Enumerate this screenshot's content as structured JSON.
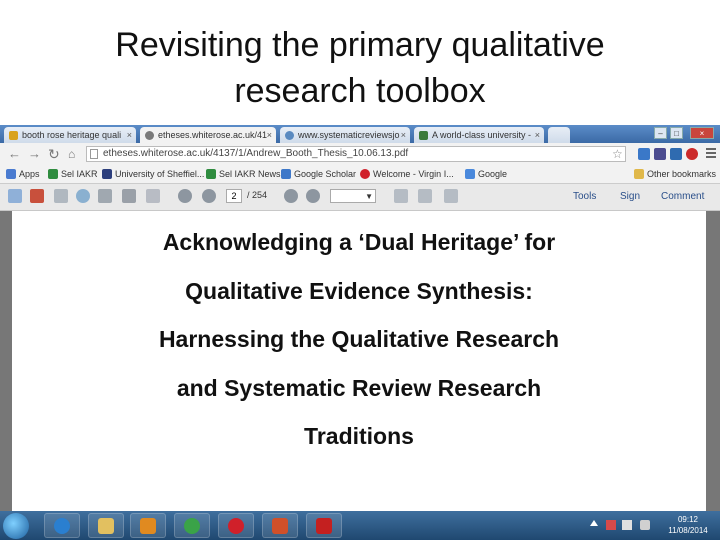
{
  "slide": {
    "title_line1": "Revisiting the primary qualitative",
    "title_line2": "research toolbox"
  },
  "browser": {
    "tabs": [
      {
        "label": "booth rose heritage quali",
        "color": "#d9a21b"
      },
      {
        "label": "etheses.whiterose.ac.uk/41",
        "color": "#7a7a7a"
      },
      {
        "label": "www.systematicreviewsjo",
        "color": "#5a8ac0"
      },
      {
        "label": "A world-class university -",
        "color": "#3b7a3b"
      }
    ],
    "address": "etheses.whiterose.ac.uk/4137/1/Andrew_Booth_Thesis_10.06.13.pdf",
    "bookmarks": [
      {
        "label": "Apps",
        "color": "#4a7bd0"
      },
      {
        "label": "Sel IAKR",
        "color": "#2f8c3f"
      },
      {
        "label": "University of Sheffiel...",
        "color": "#2c3e7c"
      },
      {
        "label": "Sel IAKR News",
        "color": "#2f8c3f"
      },
      {
        "label": "Google Scholar",
        "color": "#3e78c9"
      },
      {
        "label": "Welcome - Virgin I...",
        "color": "#d0202a"
      },
      {
        "label": "Google",
        "color": "#4a89dc"
      }
    ],
    "other_bookmarks": "Other bookmarks"
  },
  "pdf_toolbar": {
    "page_current": "2",
    "page_total": "/ 254",
    "tools": "Tools",
    "sign": "Sign",
    "comment": "Comment"
  },
  "document": {
    "lines": [
      "Acknowledging a ‘Dual Heritage’ for",
      "Qualitative Evidence Synthesis:",
      "Harnessing the Qualitative Research",
      "and Systematic Review Research",
      "Traditions"
    ]
  },
  "taskbar": {
    "time": "09:12",
    "date": "11/08/2014"
  }
}
